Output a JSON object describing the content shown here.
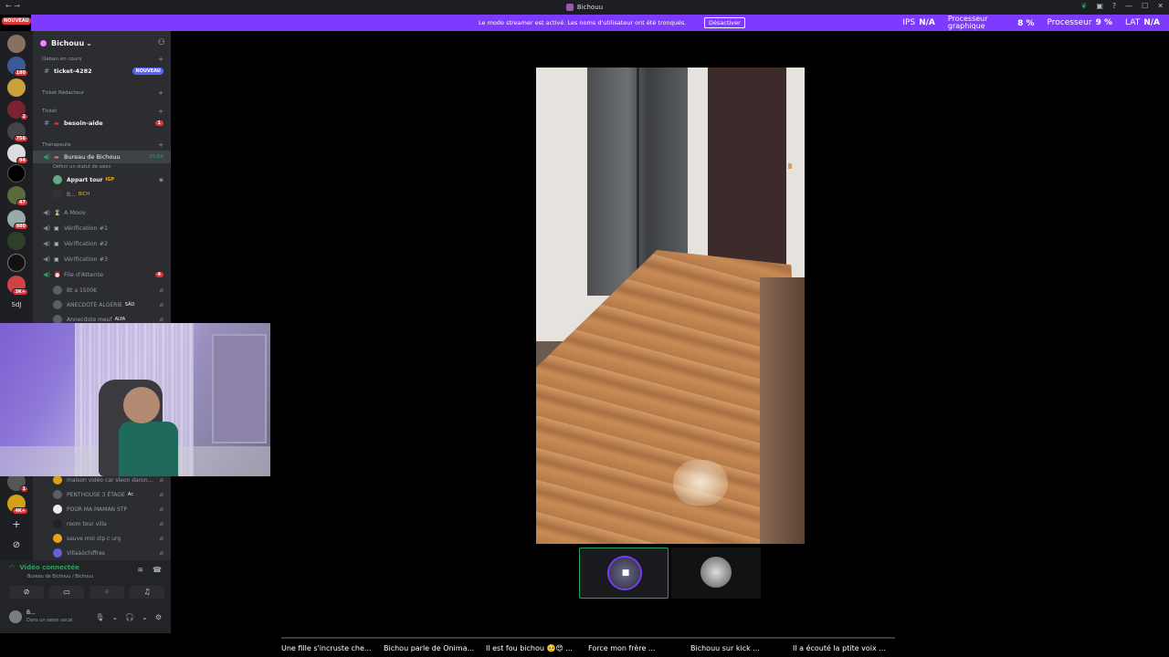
{
  "window": {
    "title": "Bichouu",
    "nav_back": "←",
    "nav_fwd": "→"
  },
  "banner": {
    "message": "Le mode streamer est activé. Les noms d'utilisateur ont été tronqués.",
    "button": "Désactiver",
    "ips_label": "IPS",
    "ips_value": "N/A",
    "gpu_label_1": "Processeur",
    "gpu_label_2": "graphique",
    "gpu_value": "8 %",
    "cpu_label": "Processeur",
    "cpu_value": "9 %",
    "lat_label": "LAT",
    "lat_value": "N/A"
  },
  "serverbar": {
    "top_badge": "NOUVEAU",
    "badges": [
      "180",
      "2",
      "756",
      "94",
      "47",
      "980",
      "3K+",
      "1",
      "4K+"
    ],
    "sdj": "SdJ",
    "add": "+",
    "discover": "⊘"
  },
  "guild": {
    "name": "Bichouu",
    "chevron": "⌄"
  },
  "sidebar": {
    "cat_deban": "Deban en cours",
    "ticket_4282": "ticket-4282",
    "nouveau": "NOUVEAU",
    "cat_ticket_redacteur": "Ticket Rédacteur",
    "cat_ticket": "Ticket",
    "besoin_aide": "besoin-aide",
    "besoin_aide_count": "1",
    "cat_therapeute": "Thérapeute",
    "bureau": "Bureau de Bichouu",
    "bureau_time": "25:64",
    "bureau_status": "Définir un statut de salon",
    "user1": "Appart tour",
    "user1_tag": "IGP",
    "user2": "B...",
    "user2_tag": "BICH",
    "a_moov": "A Moov",
    "verif1": "Vérification #1",
    "verif2": "Vérification #2",
    "verif3": "Vérification #3",
    "file_attente": "File d'Attente",
    "file_count": "4",
    "fu1": "Bt a 1500K",
    "fu2": "ANECDOTE ALGÉRIE",
    "fu2_tag": "SÃO",
    "fu3": "Annecdote meuf",
    "fu3_tag": "ALYA",
    "fu4": "maison vidéo car sleon daron...",
    "fu5": "PENTHOUSE 3 ÉTAGE",
    "fu5_tag": "Ac",
    "fu6": "POUR MA MAMAN STP",
    "fu7": "room tour villa",
    "fu8": "sauve moi stp c urg",
    "fu9": "Villaàòchiffres"
  },
  "voice_panel": {
    "status": "Vidéo connectée",
    "channel": "Bureau de Bichouu / Bichouu",
    "username": "B...",
    "user_status": "Dans un salon vocal"
  },
  "captions": [
    "Une fille s'incruste che...",
    "Bichou parle de Onima...",
    "Il est fou bichou 🥺😍 ...",
    "Force mon frère ...",
    "Bichouu sur kick ...",
    "Il a écouté la ptite voix ..."
  ],
  "colors": {
    "accent": "#7e3bff",
    "connected": "#23a55a",
    "badge_red": "#da373c",
    "blurple": "#5865f2"
  }
}
